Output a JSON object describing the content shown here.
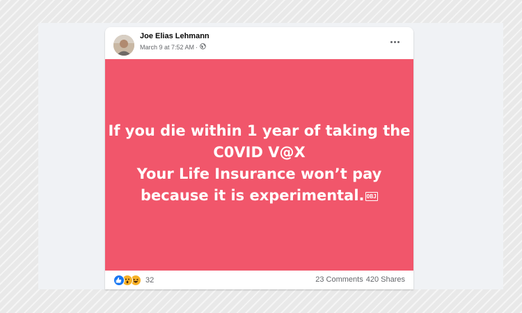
{
  "post": {
    "author": "Joe Elias Lehmann",
    "date": "March 9 at 7:52 AM",
    "date_separator": "·",
    "audience_icon": "globe-icon",
    "image_text": {
      "line1": "If you die within 1 year of taking the",
      "line2": "C0VID V@X",
      "line3": "Your Life Insurance won’t pay",
      "line4": "because it is experimental.",
      "line4_glyph": "OBJ"
    },
    "image_background": "#f1566b"
  },
  "footer": {
    "reactions": [
      "like-icon",
      "wow-icon",
      "haha-icon"
    ],
    "reaction_count": "32",
    "comments": "23 Comments",
    "shares": "420 Shares"
  },
  "colors": {
    "accent_blue": "#1877f2",
    "reaction_yellow": "#f7b125",
    "meta_gray": "#65676b"
  }
}
